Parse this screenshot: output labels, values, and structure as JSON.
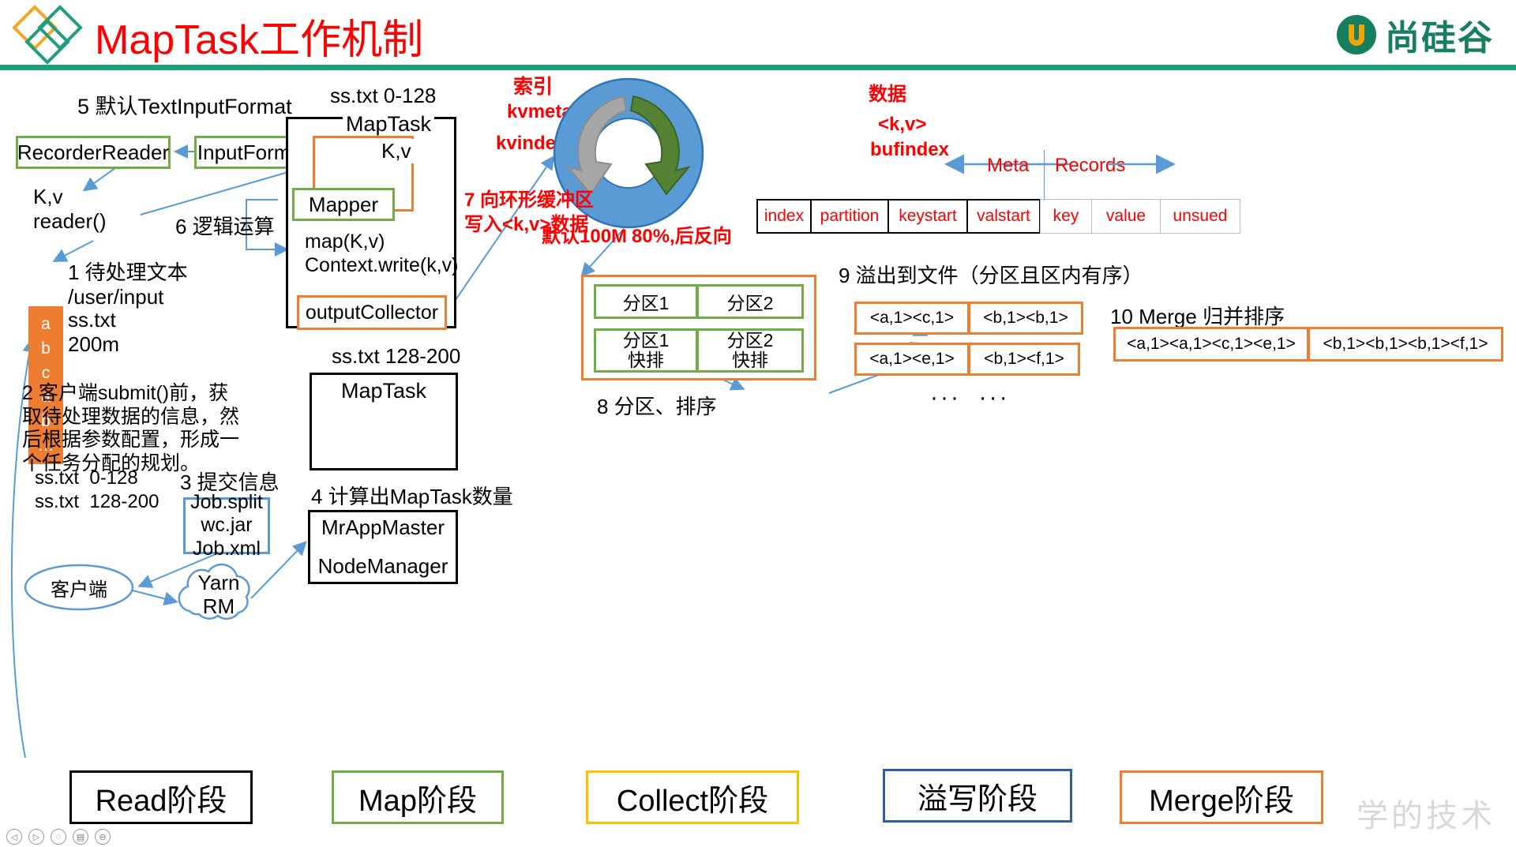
{
  "header": {
    "title": "MapTask工作机制",
    "brand": "尚硅谷",
    "logo_icon": "diamonds-logo-icon",
    "brand_icon": "atguigu-u-icon",
    "rule_color": "#1F9E7F",
    "title_color": "#FF0000",
    "brand_color": "#157F5F"
  },
  "left": {
    "step5_label": "5 默认TextInputFormat",
    "recorder_reader": "RecorderReader",
    "input_format": "InputFormat",
    "kv_reader": "K,v\nreader()",
    "step6_label": "6 逻辑运算",
    "data_column": [
      "a",
      "b",
      "c",
      "a",
      "b",
      "…"
    ],
    "step1_label": "1 待处理文本\n/user/input",
    "file_label": "ss.txt\n200m",
    "step2_label": "2 客户端submit()前，获\n取待处理数据的信息，然\n后根据参数配置，形成一\n个任务分配的规划。",
    "splits": [
      "ss.txt  0-128",
      "ss.txt  128-200"
    ],
    "step3_label": "3 提交信息",
    "job_files": "Job.split\nwc.jar\nJob.xml",
    "client": "客户端",
    "yarn": "Yarn\nRM",
    "step4_label": "4 计算出MapTask数量",
    "appmaster": "MrAppMaster",
    "nodemanager": "NodeManager"
  },
  "maptask": {
    "split_top": "ss.txt 0-128",
    "title": "MapTask",
    "kv": "K,v",
    "mapper": "Mapper",
    "map_call": "map(K,v)\nContext.write(k,v)",
    "output_collector": "outputCollector",
    "split_bottom": "ss.txt 128-200",
    "title2": "MapTask"
  },
  "ring": {
    "index_label": "索引",
    "kvmeta": "kvmeta",
    "kvindex": "kvindex",
    "data_label": "数据",
    "kv": "<k,v>",
    "bufindex": "bufindex",
    "step7_label": "7 向环形缓冲区\n写入<k,v>数据",
    "size_label": "默认100M",
    "threshold_label": "80%,后反向",
    "ring_color": "#5B9BD5",
    "meta_arrow_color": "#A6A6A6",
    "data_arrow_color": "#548235"
  },
  "meta_table": {
    "meta_label": "Meta",
    "records_label": "Records",
    "dark_cells": [
      "index",
      "partition",
      "keystart",
      "valstart"
    ],
    "light_cells": [
      "key",
      "value",
      "unsued"
    ]
  },
  "partition": {
    "step8_label": "8 分区、排序",
    "row1": [
      "分区1",
      "分区2"
    ],
    "row2": [
      "分区1\n快排",
      "分区2\n快排"
    ]
  },
  "spill": {
    "step9_label": "9 溢出到文件（分区且区内有序）",
    "file1": [
      "<a,1><c,1>",
      "<b,1><b,1>"
    ],
    "file2": [
      "<a,1><e,1>",
      "<b,1><f,1>"
    ],
    "ellipsis": "···  ···"
  },
  "merge": {
    "step10_label": "10 Merge 归并排序",
    "cells": [
      "<a,1><a,1><c,1><e,1>",
      "<b,1><b,1><b,1><f,1>"
    ]
  },
  "stages": [
    {
      "label": "Read阶段",
      "color": "#000000"
    },
    {
      "label": "Map阶段",
      "color": "#70AD47"
    },
    {
      "label": "Collect阶段",
      "color": "#FFC000"
    },
    {
      "label": "溢写阶段",
      "color": "#2E5FA3"
    },
    {
      "label": "Merge阶段",
      "color": "#ED7D31"
    }
  ],
  "watermark": "学的技术",
  "tray": [
    "◁",
    "▷",
    "◌",
    "▤",
    "⊖"
  ]
}
